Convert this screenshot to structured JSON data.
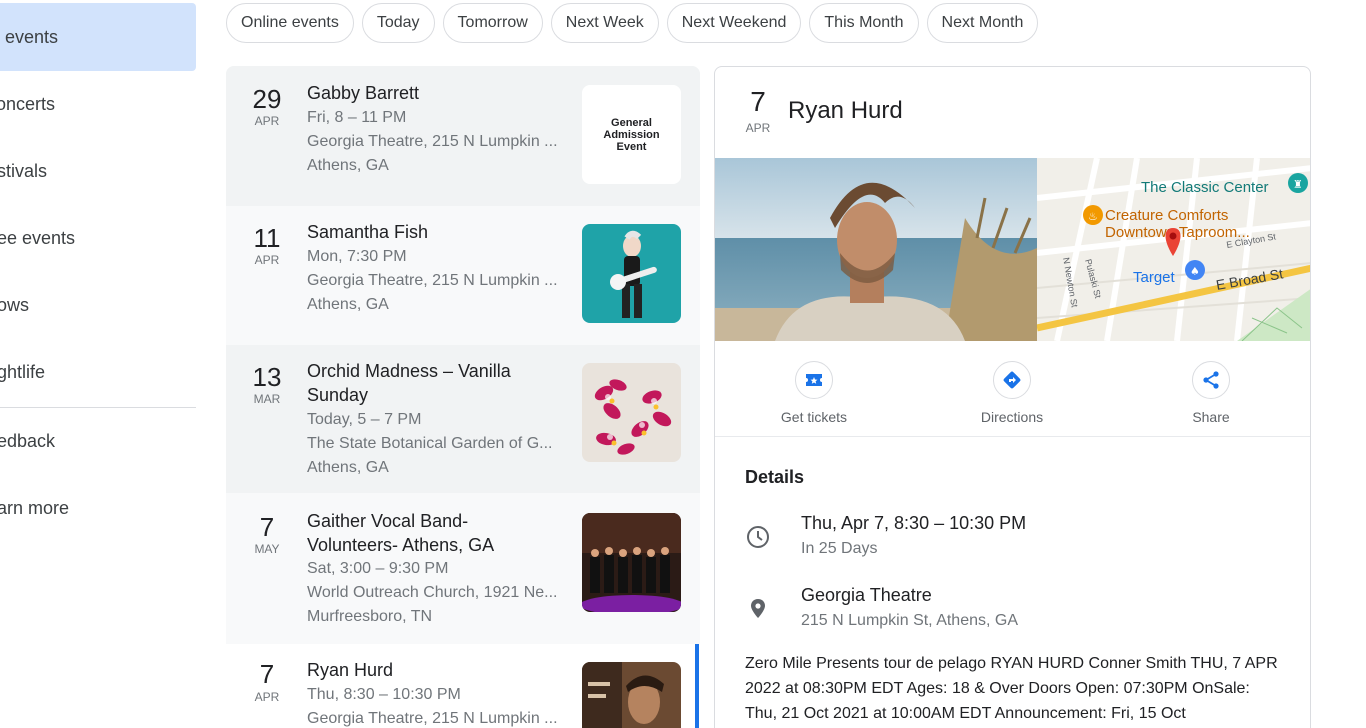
{
  "sidebar": {
    "items": [
      {
        "label": "All events",
        "visible": "l events"
      },
      {
        "label": "Concerts",
        "visible": "oncerts"
      },
      {
        "label": "Festivals",
        "visible": "stivals"
      },
      {
        "label": "Free events",
        "visible": "ee events"
      },
      {
        "label": "Shows",
        "visible": "ows"
      },
      {
        "label": "Nightlife",
        "visible": "ghtlife"
      },
      {
        "label": "Feedback",
        "visible": "edback"
      },
      {
        "label": "Learn more",
        "visible": "arn more"
      }
    ]
  },
  "filters": [
    "Online events",
    "Today",
    "Tomorrow",
    "Next Week",
    "Next Weekend",
    "This Month",
    "Next Month"
  ],
  "events": [
    {
      "day": "29",
      "month": "APR",
      "title": "Gabby Barrett",
      "time": "Fri, 8 – 11 PM",
      "venue": "Georgia Theatre, 215 N Lumpkin ...",
      "city": "Athens, GA",
      "thumb_text": "General Admission Event"
    },
    {
      "day": "11",
      "month": "APR",
      "title": "Samantha Fish",
      "time": "Mon, 7:30 PM",
      "venue": "Georgia Theatre, 215 N Lumpkin ...",
      "city": "Athens, GA"
    },
    {
      "day": "13",
      "month": "MAR",
      "title": "Orchid Madness – Vanilla Sunday",
      "time": "Today, 5 – 7 PM",
      "venue": "The State Botanical Garden of G...",
      "city": "Athens, GA"
    },
    {
      "day": "7",
      "month": "MAY",
      "title": "Gaither Vocal Band- Volunteers- Athens, GA",
      "time": "Sat, 3:00 – 9:30 PM",
      "venue": "World Outreach Church, 1921 Ne...",
      "city": "Murfreesboro, TN"
    },
    {
      "day": "7",
      "month": "APR",
      "title": "Ryan Hurd",
      "time": "Thu, 8:30 – 10:30 PM",
      "venue": "Georgia Theatre, 215 N Lumpkin ..."
    }
  ],
  "detail": {
    "day": "7",
    "month": "APR",
    "title": "Ryan Hurd",
    "map_labels": {
      "classic_center": "The Classic Center",
      "creature_comforts": "Creature Comforts",
      "downtown_taproom": "Downtown Taproom...",
      "target": "Target",
      "e_broad": "E Broad St",
      "e_clayton": "E Clayton St",
      "n_newton": "N Newton St",
      "pulaski": "Pulaski St"
    },
    "actions": {
      "tickets": "Get tickets",
      "directions": "Directions",
      "share": "Share"
    },
    "details_heading": "Details",
    "datetime": "Thu, Apr 7, 8:30 – 10:30 PM",
    "relative": "In 25 Days",
    "venue": "Georgia Theatre",
    "address": "215 N Lumpkin St, Athens, GA",
    "description": "Zero Mile Presents tour de pelago RYAN HURD Conner Smith THU, 7 APR 2022 at 08:30PM EDT Ages: 18 & Over Doors Open: 07:30PM OnSale: Thu, 21 Oct 2021 at 10:00AM EDT Announcement: Fri, 15 Oct"
  },
  "colors": {
    "accent": "#1a73e8",
    "active_bg": "#d2e3fc",
    "map_pin": "#ea4335"
  }
}
